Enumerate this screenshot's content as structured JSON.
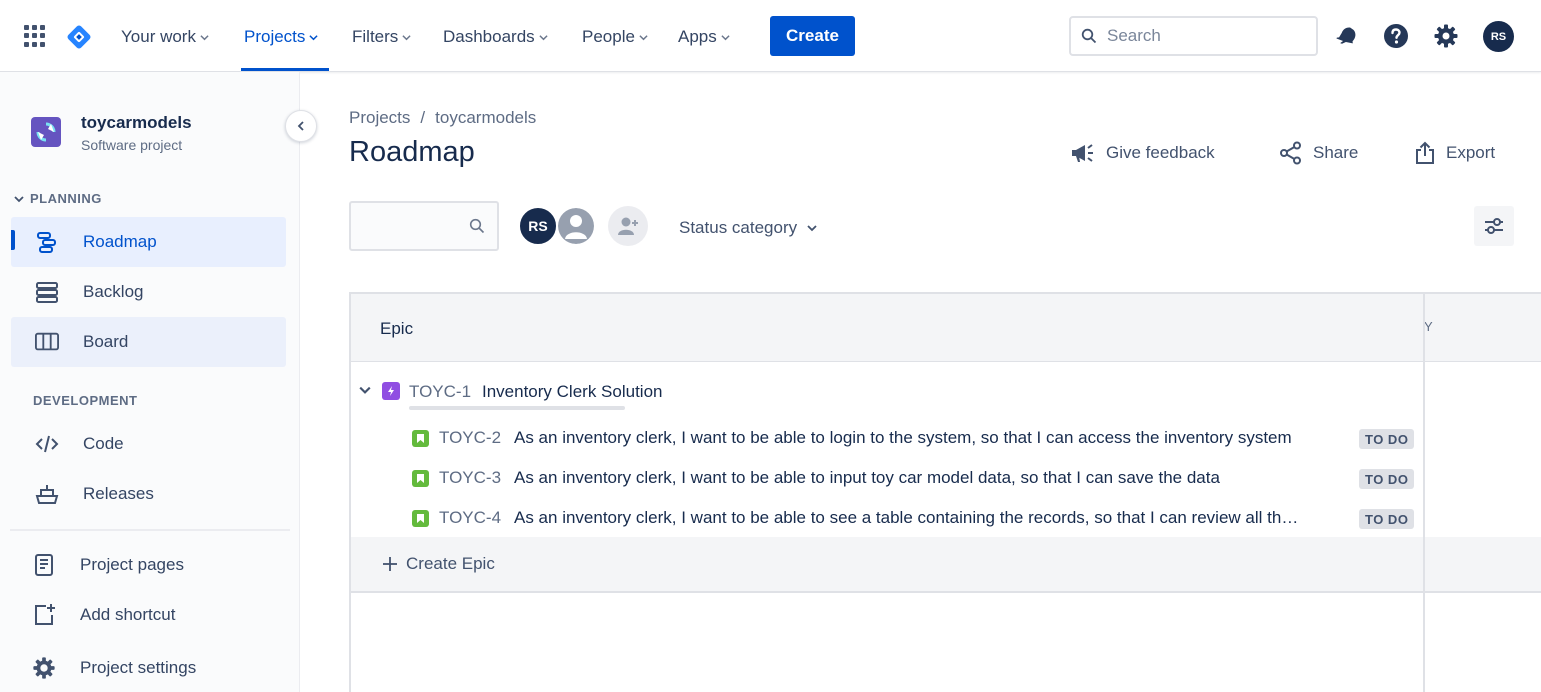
{
  "topnav": {
    "items": [
      {
        "label": "Your work"
      },
      {
        "label": "Projects"
      },
      {
        "label": "Filters"
      },
      {
        "label": "Dashboards"
      },
      {
        "label": "People"
      },
      {
        "label": "Apps"
      }
    ],
    "active_item": "Projects",
    "create_label": "Create",
    "search_placeholder": "Search",
    "user_initials": "RS",
    "accent_color": "#0052cc"
  },
  "sidebar": {
    "project_name": "toycarmodels",
    "project_type": "Software project",
    "planning_heading": "PLANNING",
    "planning_items": [
      {
        "label": "Roadmap",
        "icon": "roadmap-icon",
        "selected": true
      },
      {
        "label": "Backlog",
        "icon": "backlog-icon"
      },
      {
        "label": "Board",
        "icon": "board-icon"
      }
    ],
    "development_heading": "DEVELOPMENT",
    "development_items": [
      {
        "label": "Code",
        "icon": "code-icon"
      },
      {
        "label": "Releases",
        "icon": "releases-icon"
      }
    ],
    "footer_items": [
      {
        "label": "Project pages",
        "icon": "project-pages-icon"
      },
      {
        "label": "Add shortcut",
        "icon": "add-shortcut-icon"
      },
      {
        "label": "Project settings",
        "icon": "gear-icon"
      }
    ]
  },
  "main": {
    "breadcrumb": {
      "root": "Projects",
      "separator": "/",
      "current": "toycarmodels"
    },
    "title": "Roadmap",
    "actions": {
      "feedback": "Give feedback",
      "share": "Share",
      "export": "Export"
    },
    "filter_avatar_initials": "RS",
    "status_filter_label": "Status category"
  },
  "roadmap": {
    "column_header": "Epic",
    "timeline_label": "Y",
    "epic": {
      "key": "TOYC-1",
      "title": "Inventory Clerk Solution"
    },
    "stories": [
      {
        "key": "TOYC-2",
        "title": "As an inventory clerk, I want to be able to login to the system, so that I can access the inventory system",
        "status": "TO DO"
      },
      {
        "key": "TOYC-3",
        "title": "As an inventory clerk, I want to be able to input toy car model data, so that I can save the data",
        "status": "TO DO"
      },
      {
        "key": "TOYC-4",
        "title": "As an inventory clerk, I want to be able to see a table containing the records, so that I can review all th…",
        "status": "TO DO"
      }
    ],
    "create_epic_label": "Create Epic"
  }
}
